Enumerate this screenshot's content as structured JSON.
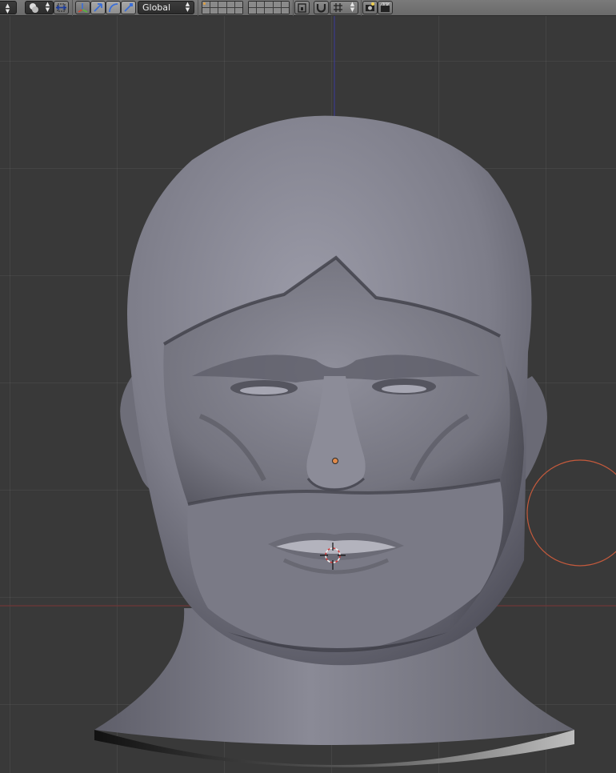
{
  "header": {
    "orientation_select": {
      "value": "Global"
    },
    "icons": {
      "mode_dropdown": "circle-dropdown-icon",
      "pivot": "pivot-point-icon",
      "manipulator": "manipulator-toggle-icon",
      "translate": "translate-manipulator-icon",
      "rotate": "rotate-manipulator-icon",
      "scale": "scale-manipulator-icon",
      "layers_a": "scene-layers-grid",
      "layers_b": "scene-layers-grid",
      "lock": "lock-camera-to-view-icon",
      "snap_toggle": "snap-magnet-icon",
      "snap_element": "snap-increment-icon",
      "render_image": "render-camera-icon",
      "render_anim": "render-animation-icon"
    }
  },
  "viewport": {
    "object": "sculpted-head-mesh",
    "cursor": "3d-cursor",
    "brush": "brush-radius-circle",
    "colors": {
      "background": "#393939",
      "x_axis": "#8b3a3a",
      "z_axis": "#3b3b9a",
      "brush": "#c55a3c",
      "origin": "#e08a4a"
    }
  }
}
